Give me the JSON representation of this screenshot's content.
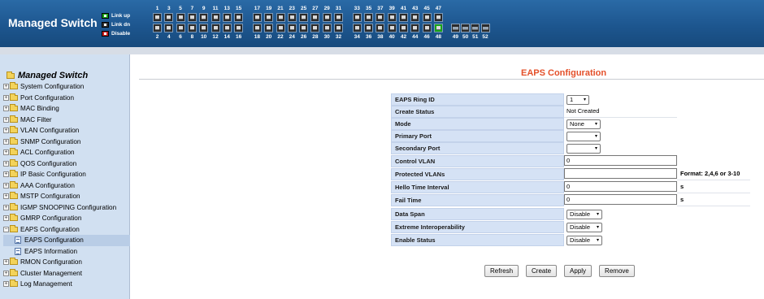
{
  "header": {
    "brand": "Managed Switch",
    "legend": {
      "link_up": "Link up",
      "link_dn": "Link dn",
      "disable": "Disable"
    },
    "ports_top": [
      "1",
      "3",
      "5",
      "7",
      "9",
      "11",
      "13",
      "15",
      "17",
      "19",
      "21",
      "23",
      "25",
      "27",
      "29",
      "31",
      "33",
      "35",
      "37",
      "39",
      "41",
      "43",
      "45",
      "47"
    ],
    "ports_bottom": [
      "2",
      "4",
      "6",
      "8",
      "10",
      "12",
      "14",
      "16",
      "18",
      "20",
      "22",
      "24",
      "26",
      "28",
      "30",
      "32",
      "34",
      "36",
      "38",
      "40",
      "42",
      "44",
      "46",
      "48",
      "49",
      "50",
      "51",
      "52"
    ],
    "linked_up_port": "48",
    "colors": {
      "link_up": "#18a418",
      "link_dn": "#2f2f2f",
      "disable": "#c81d1d"
    }
  },
  "sidebar": {
    "title": "Managed Switch",
    "items": [
      {
        "label": "System Configuration",
        "expanded": false
      },
      {
        "label": "Port Configuration",
        "expanded": false
      },
      {
        "label": "MAC Binding",
        "expanded": false
      },
      {
        "label": "MAC Filter",
        "expanded": false
      },
      {
        "label": "VLAN Configuration",
        "expanded": false
      },
      {
        "label": "SNMP Configuration",
        "expanded": false
      },
      {
        "label": "ACL Configuration",
        "expanded": false
      },
      {
        "label": "QOS Configuration",
        "expanded": false
      },
      {
        "label": "IP Basic Configuration",
        "expanded": false
      },
      {
        "label": "AAA Configuration",
        "expanded": false
      },
      {
        "label": "MSTP Configuration",
        "expanded": false
      },
      {
        "label": "IGMP SNOOPING Configuration",
        "expanded": false
      },
      {
        "label": "GMRP Configuration",
        "expanded": false
      },
      {
        "label": "EAPS Configuration",
        "expanded": true
      },
      {
        "label": "RMON Configuration",
        "expanded": false
      },
      {
        "label": "Cluster Management",
        "expanded": false
      },
      {
        "label": "Log Management",
        "expanded": false
      }
    ],
    "eaps_children": [
      "EAPS Configuration",
      "EAPS Information"
    ]
  },
  "main": {
    "title": "EAPS Configuration",
    "fields": {
      "ring_id": {
        "label": "EAPS Ring ID",
        "value": "1"
      },
      "create_status": {
        "label": "Create Status",
        "value": "Not Created"
      },
      "mode": {
        "label": "Mode",
        "value": "None"
      },
      "primary_port": {
        "label": "Primary Port",
        "value": ""
      },
      "secondary_port": {
        "label": "Secondary Port",
        "value": ""
      },
      "control_vlan": {
        "label": "Control VLAN",
        "value": "0"
      },
      "protected_vlans": {
        "label": "Protected VLANs",
        "value": "",
        "hint": "Format: 2,4,6 or 3-10"
      },
      "hello_time": {
        "label": "Hello Time Interval",
        "value": "0",
        "unit": "s"
      },
      "fail_time": {
        "label": "Fail Time",
        "value": "0",
        "unit": "s"
      },
      "data_span": {
        "label": "Data Span",
        "value": "Disable"
      },
      "extreme_interop": {
        "label": "Extreme Interoperability",
        "value": "Disable"
      },
      "enable_status": {
        "label": "Enable Status",
        "value": "Disable"
      }
    },
    "buttons": {
      "refresh": "Refresh",
      "create": "Create",
      "apply": "Apply",
      "remove": "Remove"
    }
  }
}
